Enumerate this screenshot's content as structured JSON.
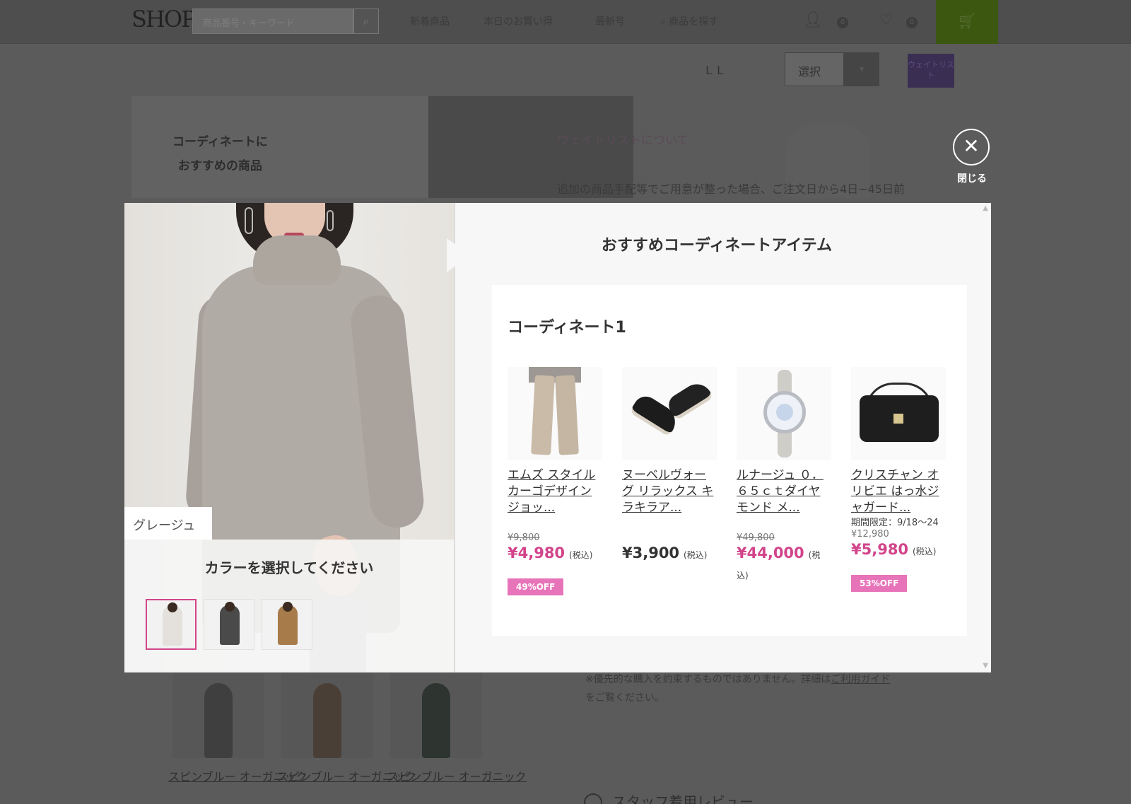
{
  "header": {
    "logo": "SHOP",
    "search_placeholder": "商品番号・キーワード",
    "nav": [
      "新着商品",
      "本日のお買い得",
      "最新号",
      "商品を探す"
    ],
    "account_count": "0",
    "favorite_count": "0"
  },
  "page": {
    "size_value": "ＬＬ",
    "select_label": "選択",
    "waitlist_badge": "ウェイトリスト",
    "banner_text": [
      "コーディネートに",
      "おすすめの商品"
    ],
    "waitlist_heading": "ウェイトリストについて",
    "waitlist_text": "追加の商品手配等でご用意が整った場合、ご注文日から4日~45日前",
    "note_text": "※優先的な購入を約束するものではありません。詳細は",
    "note_link": "ご利用ガイド",
    "note_suffix": "をご覧ください。",
    "related_products": [
      "スピンブルー オーガニック",
      "スピンブルー オーガニック",
      "スピンブルー オーガニック"
    ],
    "review_heading": "スタッフ着用レビュー"
  },
  "close": {
    "icon": "close-icon",
    "label": "閉じる"
  },
  "modal": {
    "title": "おすすめコーディネートアイテム",
    "color_name": "グレージュ",
    "choose_color": "カラーを選択してください",
    "swatches": [
      {
        "name": "greige",
        "color": "#d9d4ce",
        "active": true
      },
      {
        "name": "charcoal",
        "color": "#4a4a4a",
        "active": false
      },
      {
        "name": "camel",
        "color": "#a77b4a",
        "active": false
      }
    ],
    "coordinate": {
      "title": "コーディネート1",
      "items": [
        {
          "name": "エムズ スタイル カーゴデザイン ジョッ...",
          "limited": "",
          "original_price": "¥9,800",
          "price": "¥4,980",
          "tax": "(税込)",
          "badge": "49%OFF"
        },
        {
          "name": "ヌーベルヴォーグ リラックス キラキラア...",
          "limited": "",
          "original_price": "",
          "price": "¥3,900",
          "tax": "(税込)",
          "badge": ""
        },
        {
          "name": "ルナージュ ０．６５ｃｔダイヤモンド メ...",
          "limited": "",
          "original_price": "¥49,800",
          "price": "¥44,000",
          "tax": "(税込)",
          "badge": ""
        },
        {
          "name": "クリスチャン オリビエ はっ水ジャガード...",
          "limited": "期間限定：9/18～24",
          "original_price": "¥12,980",
          "price": "¥5,980",
          "tax": "(税込)",
          "badge": "53%OFF"
        }
      ]
    }
  },
  "colors": {
    "accent_pink": "#d2448a",
    "badge_pink": "#e774b9",
    "cart_green": "#3b5710"
  }
}
